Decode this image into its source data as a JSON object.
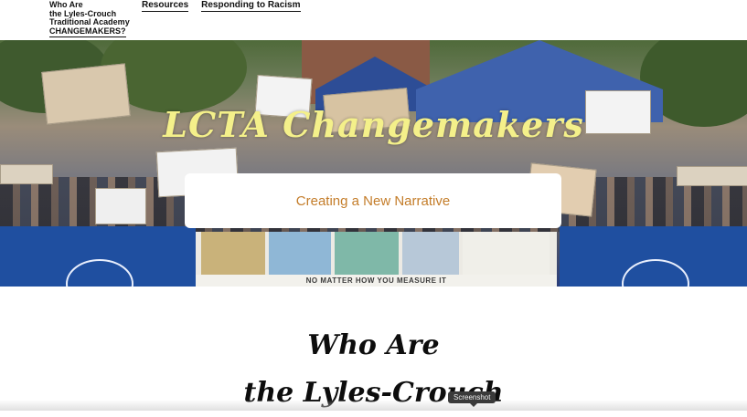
{
  "header": {
    "site_title_line1": "Who Are",
    "site_title_line2": "the Lyles-Crouch",
    "site_title_line3": "Traditional Academy",
    "site_title_line4": "CHANGEMAKERS?",
    "nav": [
      {
        "label": "Resources"
      },
      {
        "label": "Responding to Racism"
      }
    ]
  },
  "hero": {
    "title": "LCTA Changemakers",
    "subtitle": "Creating a New Narrative",
    "banner_text": "NO MATTER HOW YOU MEASURE IT"
  },
  "main": {
    "heading_line1": "Who Are",
    "heading_line2": "the Lyles-Crouch"
  },
  "tooltip": {
    "text": "Screenshot"
  },
  "colors": {
    "hero_title": "#f4f08a",
    "subtitle": "#c47d2a",
    "barrier_blue": "#1f4fa0"
  }
}
